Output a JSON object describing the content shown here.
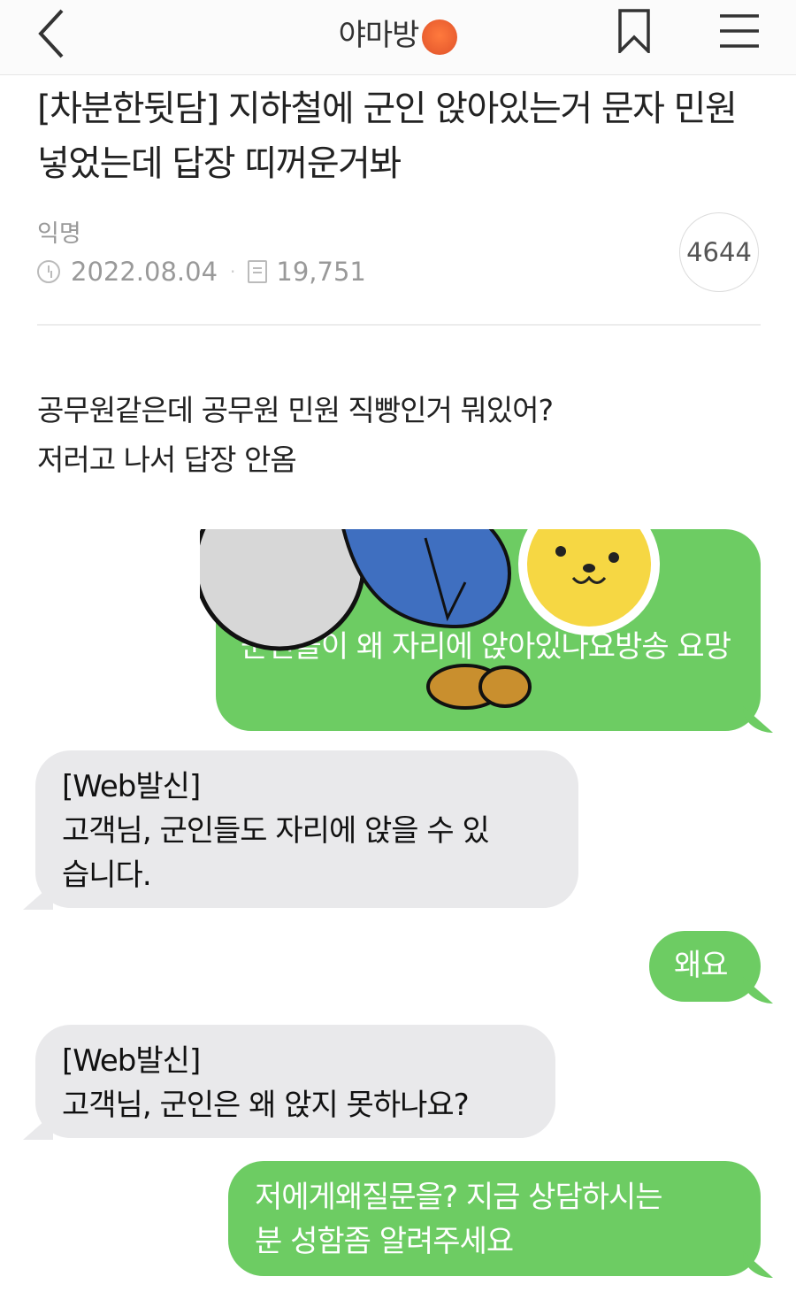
{
  "header": {
    "board_name": "야마방",
    "emoji": "angry-face-emoji"
  },
  "post": {
    "title": "[차분한뒷담] 지하철에 군인 앉아있는거 문자 민원 넣었는데 답장 띠꺼운거봐",
    "author": "익명",
    "date": "2022.08.04",
    "views": "19,751",
    "comment_count": "4644",
    "body_lines": [
      "공무원같은데 공무원 민원 직빵인거 뭐있어?",
      "저러고 나서 답장 안옴"
    ]
  },
  "messages": [
    {
      "side": "right",
      "text": "군인들이 왜 자리에 앉아있나요방송 요망"
    },
    {
      "side": "left",
      "lines": [
        "[Web발신]",
        "고객님, 군인들도 자리에 앉을 수 있",
        "습니다."
      ]
    },
    {
      "side": "right",
      "text": "왜요"
    },
    {
      "side": "left",
      "lines": [
        "[Web발신]",
        "고객님, 군인은 왜 앉지 못하나요?"
      ]
    },
    {
      "side": "right",
      "lines": [
        "저에게왜질문을? 지금 상담하시는",
        "분 성함좀 알려주세요"
      ]
    }
  ],
  "colors": {
    "sent_bubble": "#6dcc63",
    "received_bubble": "#e9e9eb",
    "meta_text": "#999999"
  }
}
